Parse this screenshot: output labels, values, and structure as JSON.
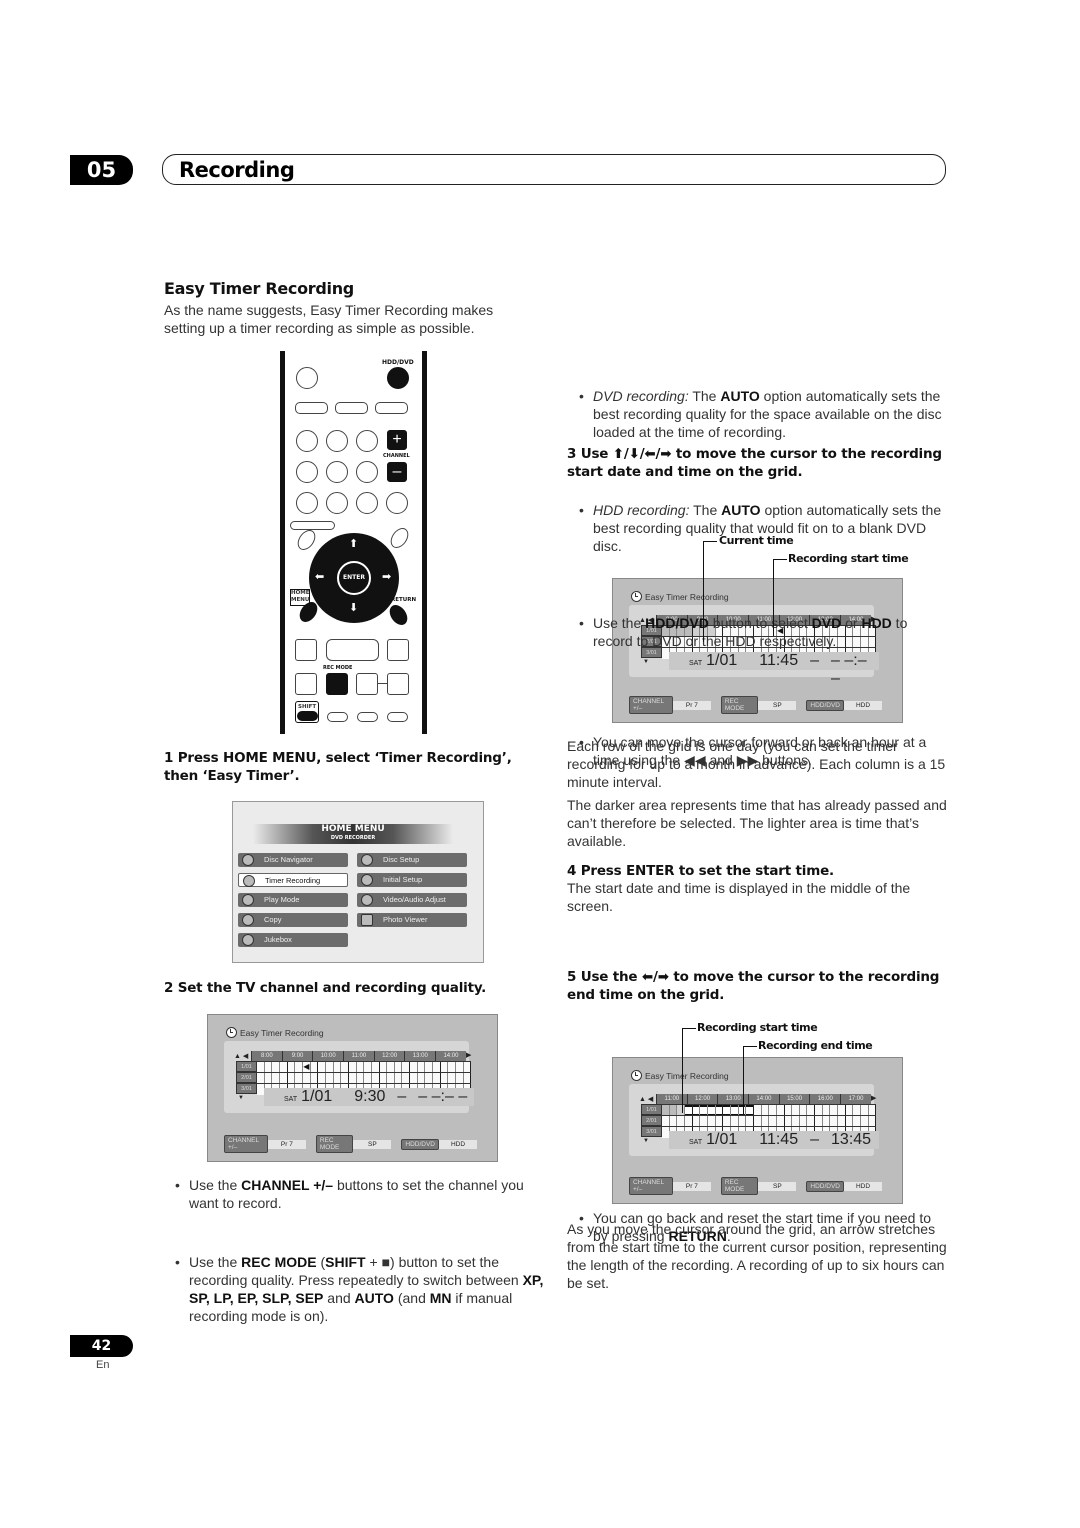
{
  "header": {
    "chapter_number": "05",
    "chapter_title": "Recording"
  },
  "left": {
    "section_title": "Easy Timer Recording",
    "intro": "As the name suggests, Easy Timer Recording makes setting up a timer recording as simple as possible.",
    "remote": {
      "labels": {
        "hdd_dvd": "HDD/DVD",
        "channel": "CHANNEL",
        "enter": "ENTER",
        "home_menu_1": "HOME",
        "home_menu_2": "MENU",
        "return": "RETURN",
        "rec_mode": "REC MODE",
        "shift": "SHIFT",
        "plus": "+",
        "minus": "–"
      }
    },
    "step1": "1    Press HOME MENU, select ‘Timer Recording’, then ‘Easy Timer’.",
    "home_menu": {
      "title": "HOME MENU",
      "subtitle": "DVD RECORDER",
      "left_items": [
        "Disc Navigator",
        "Timer Recording",
        "Play Mode",
        "Copy",
        "Jukebox"
      ],
      "right_items": [
        "Disc Setup",
        "Initial Setup",
        "Video/Audio Adjust",
        "Photo Viewer"
      ],
      "selected": "Timer Recording"
    },
    "step2": "2    Set the TV channel and recording quality.",
    "bullets": [
      {
        "pre": "Use the ",
        "b1": "CHANNEL +/–",
        "post": " buttons to set the channel you want to record."
      },
      {
        "pre": "Use the ",
        "b1": "REC MODE",
        "mid1": " (",
        "b2": "SHIFT",
        "mid2": " + ■) button to set the recording quality. Press repeatedly to switch between ",
        "modes": "XP, SP, LP, EP, SLP, SEP",
        "mid3": " and ",
        "b3": "AUTO",
        "mid4": " (and ",
        "b4": "MN",
        "post": " if manual recording mode is on)."
      }
    ]
  },
  "screens": [
    {
      "title": "Easy Timer Recording",
      "hours": [
        "8:00",
        "9:00",
        "10:00",
        "11:00",
        "12:00",
        "13:00",
        "14:00"
      ],
      "dates": [
        "1/01",
        "2/01",
        "3/01"
      ],
      "day": "SAT",
      "date": "1/01",
      "start": "9:30",
      "end": "– –:– –",
      "dash": "–",
      "channel_tag": "CHANNEL +/–",
      "channel": "Pr 7",
      "rec_mode_tag": "REC MODE",
      "rec_mode": "SP",
      "media_tag": "HDD/DVD",
      "media": "HDD"
    },
    {
      "title": "Easy Timer Recording",
      "hours": [
        "8:00",
        "9:00",
        "10:00",
        "11:00",
        "12:00",
        "13:00",
        "14:00"
      ],
      "dates": [
        "1/01",
        "2/01",
        "3/01"
      ],
      "day": "SAT",
      "date": "1/01",
      "start": "11:45",
      "end": "– –:– –",
      "dash": "–",
      "channel_tag": "CHANNEL +/–",
      "channel": "Pr 7",
      "rec_mode_tag": "REC MODE",
      "rec_mode": "SP",
      "media_tag": "HDD/DVD",
      "media": "HDD",
      "callouts": [
        "Current time",
        "Recording start time"
      ]
    },
    {
      "title": "Easy Timer Recording",
      "hours": [
        "11:00",
        "12:00",
        "13:00",
        "14:00",
        "15:00",
        "16:00",
        "17:00"
      ],
      "dates": [
        "1/01",
        "2/01",
        "3/01"
      ],
      "day": "SAT",
      "date": "1/01",
      "start": "11:45",
      "end": "13:45",
      "dash": "–",
      "channel_tag": "CHANNEL +/–",
      "channel": "Pr 7",
      "rec_mode_tag": "REC MODE",
      "rec_mode": "SP",
      "media_tag": "HDD/DVD",
      "media": "HDD",
      "callouts": [
        "Recording start time",
        "Recording end time"
      ]
    }
  ],
  "right": {
    "bullet_dvd": {
      "label": "DVD recording:",
      "pre": " The ",
      "b": "AUTO",
      "post": " option automatically sets the best recording quality for the space available on the disc loaded at the time of recording."
    },
    "bullet_hdd": {
      "label": "HDD recording:",
      "pre": " The ",
      "b": "AUTO",
      "post": " option automatically sets the best recording quality that would fit on to a blank DVD disc."
    },
    "bullet_media": {
      "pre": "Use the ",
      "b1": "HDD/DVD",
      "mid1": " button to select ",
      "b2": "DVD",
      "mid2": " or ",
      "b3": "HDD",
      "post": " to record to DVD or the HDD respectively."
    },
    "step3": "3    Use ⬆/⬇/⬅/➡ to move the cursor to the recording start date and time on the grid.",
    "step3_bullet": "You can move the cursor forward or back an hour at a time using the ◀◀ and ▶▶ buttons.",
    "para1": "Each row of the grid is one day (you can set the timer recording for up to a month in advance). Each column is a 15 minute interval.",
    "para2": "The darker area represents time that has already passed and can’t therefore be selected. The lighter area is time that’s available.",
    "step4": "4    Press ENTER to set the start time.",
    "step4_para": "The start date and time is displayed in the middle of the screen.",
    "step4_bullet": {
      "pre": "You can go back and reset the start time if you need to by pressing ",
      "b": "RETURN",
      "post": "."
    },
    "step5": "5    Use the ⬅/➡ to move the cursor to the recording end time on the grid.",
    "para3": "As you move the cursor around the grid, an arrow stretches from the start time to the current cursor position, representing the length of the recording. A recording of up to six hours can be set."
  },
  "footer": {
    "page_number": "42",
    "language": "En"
  }
}
